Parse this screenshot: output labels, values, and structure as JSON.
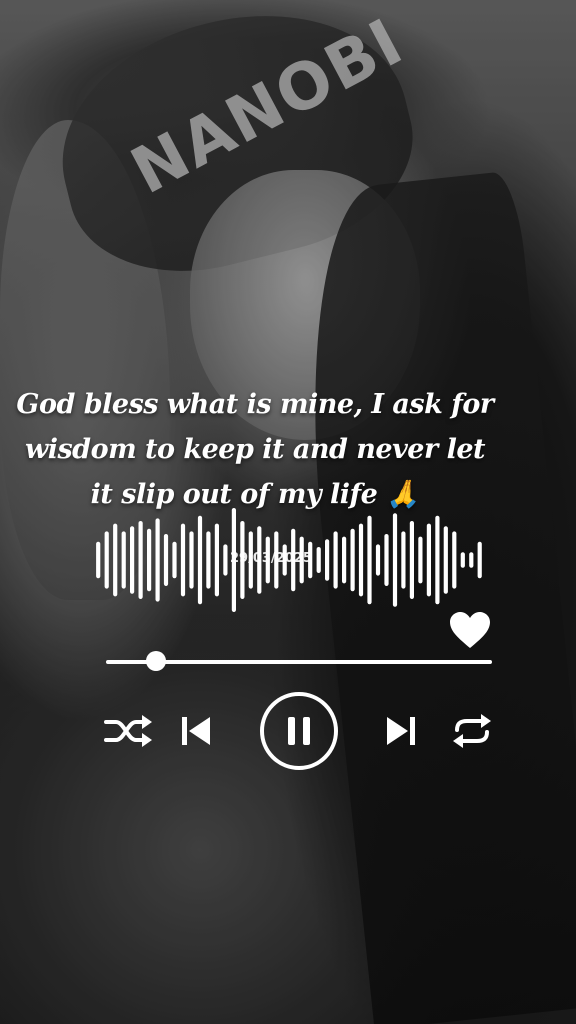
{
  "quote": {
    "text": "God bless what is mine, I ask for wisdom to keep it and never let it slip out of my life 🙏"
  },
  "waveform": {
    "date": "29/03/2025",
    "bars": [
      0.35,
      0.55,
      0.7,
      0.55,
      0.65,
      0.75,
      0.6,
      0.8,
      0.5,
      0.35,
      0.7,
      0.55,
      0.85,
      0.55,
      0.7,
      0.3,
      1.0,
      0.75,
      0.55,
      0.65,
      0.45,
      0.55,
      0.3,
      0.6,
      0.45,
      0.35,
      0.25,
      0.4,
      0.55,
      0.45,
      0.6,
      0.7,
      0.85,
      0.3,
      0.5,
      0.9,
      0.55,
      0.75,
      0.45,
      0.7,
      0.85,
      0.65,
      0.55,
      0.15,
      0.15,
      0.35
    ]
  },
  "player": {
    "progress_fraction": 0.13,
    "liked": true,
    "state": "playing"
  },
  "icons": {
    "like": "heart-icon",
    "shuffle": "shuffle-icon",
    "previous": "skip-previous-icon",
    "play_pause": "pause-icon",
    "next": "skip-next-icon",
    "repeat": "repeat-icon"
  },
  "colors": {
    "foreground": "#ffffff"
  }
}
